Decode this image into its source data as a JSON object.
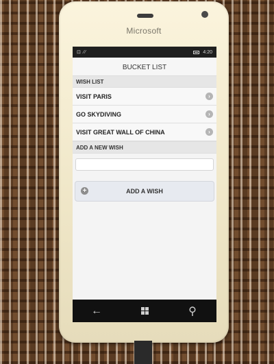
{
  "device": {
    "brand": "Microsoft"
  },
  "status_bar": {
    "left_icons": "⊡ ⁄⁄",
    "time": "4:20"
  },
  "app": {
    "title": "BUCKET LIST",
    "wish_list_header": "WISH LIST",
    "wishes": [
      {
        "label": "VISIT PARIS"
      },
      {
        "label": "GO SKYDIVING"
      },
      {
        "label": "VISIT GREAT WALL OF CHINA"
      }
    ],
    "add_section_header": "ADD A NEW WISH",
    "new_wish_value": "",
    "add_button_label": "ADD A WISH"
  },
  "nav": {
    "back_glyph": "←",
    "search_glyph": "⚲"
  },
  "colors": {
    "screen_bg": "#f4f4f4",
    "header_bg": "#e6e6e6",
    "button_bg": "#e7eaf0",
    "nav_bg": "#111111"
  }
}
